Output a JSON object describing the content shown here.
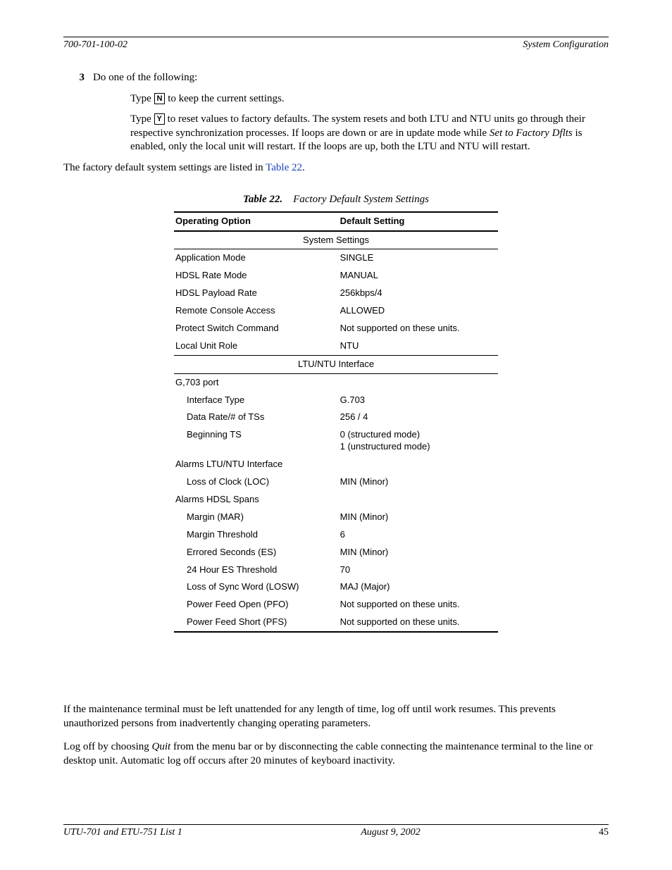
{
  "header": {
    "left": "700-701-100-02",
    "right": "System Configuration"
  },
  "step": {
    "num": "3",
    "intro": "Do one of the following:",
    "n_key": "N",
    "n_text_before": "Type ",
    "n_text_after": " to keep the current settings.",
    "y_key": "Y",
    "y_text_before": "Type ",
    "y_text_mid": " to reset values to factory defaults. The system resets and both LTU and NTU units go through their respective synchronization processes. If loops are down or are in update mode while ",
    "y_italic": "Set to Factory Dflts",
    "y_text_after": " is enabled, only the local unit will restart. If the loops are up, both the LTU and NTU will restart."
  },
  "para_defaults_before": "The factory default system settings are listed in ",
  "para_defaults_link": "Table 22",
  "para_defaults_after": ".",
  "table": {
    "caption_label": "Table 22.",
    "caption_text": "Factory Default System Settings",
    "col1": "Operating Option",
    "col2": "Default Setting",
    "sections": {
      "sys": "System Settings",
      "iface": "LTU/NTU Interface"
    },
    "rows": {
      "app_mode": {
        "k": "Application Mode",
        "v": "SINGLE"
      },
      "rate_mode": {
        "k": "HDSL Rate Mode",
        "v": "MANUAL"
      },
      "payload": {
        "k": "HDSL Payload Rate",
        "v": "256kbps/4"
      },
      "remote": {
        "k": "Remote Console Access",
        "v": "ALLOWED"
      },
      "protect": {
        "k": "Protect Switch Command",
        "v": "Not supported on these units."
      },
      "role": {
        "k": "Local Unit Role",
        "v": "NTU"
      },
      "g703port": {
        "k": "G,703 port",
        "v": ""
      },
      "iftype": {
        "k": "Interface Type",
        "v": "G.703"
      },
      "datarate": {
        "k": "Data Rate/# of TSs",
        "v": "256 / 4"
      },
      "begts": {
        "k": "Beginning TS",
        "v": "0 (structured mode)\n1 (unstructured mode)"
      },
      "alarms_if": {
        "k": "Alarms LTU/NTU Interface",
        "v": ""
      },
      "loc": {
        "k": "Loss of Clock (LOC)",
        "v": "MIN (Minor)"
      },
      "alarms_sp": {
        "k": "Alarms HDSL Spans",
        "v": ""
      },
      "mar": {
        "k": "Margin (MAR)",
        "v": "MIN (Minor)"
      },
      "marth": {
        "k": "Margin Threshold",
        "v": "6"
      },
      "es": {
        "k": "Errored Seconds (ES)",
        "v": "MIN (Minor)"
      },
      "es24": {
        "k": "24 Hour ES Threshold",
        "v": "70"
      },
      "losw": {
        "k": "Loss of Sync Word (LOSW)",
        "v": "MAJ (Major)"
      },
      "pfo": {
        "k": "Power Feed Open (PFO)",
        "v": "Not supported on these units."
      },
      "pfs": {
        "k": "Power Feed Short (PFS)",
        "v": "Not supported on these units."
      }
    }
  },
  "logoff": {
    "p1": "If the maintenance terminal must be left unattended for any length of time, log off until work resumes. This prevents unauthorized persons from inadvertently changing operating parameters.",
    "p2a": "Log off by choosing ",
    "p2_italic": "Quit",
    "p2b": " from the menu bar or by disconnecting the cable connecting the maintenance terminal to the line or desktop unit. Automatic log off occurs after 20 minutes of keyboard inactivity."
  },
  "footer": {
    "left": "UTU-701 and ETU-751 List 1",
    "center": "August 9, 2002",
    "right": "45"
  }
}
